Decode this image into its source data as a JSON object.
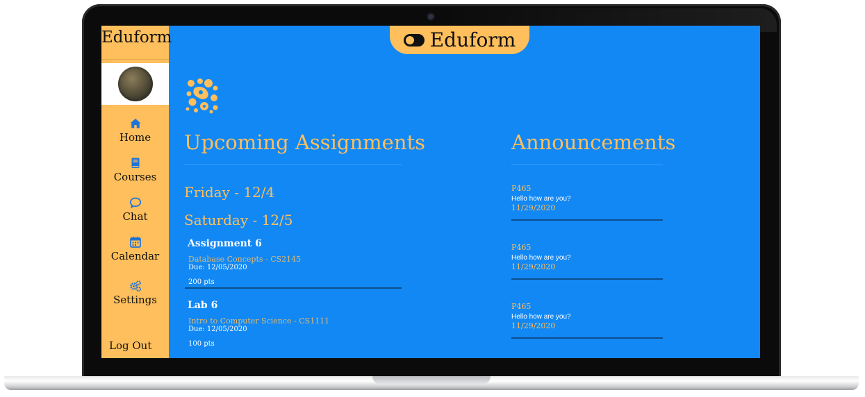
{
  "app": {
    "brand": "Eduform",
    "tab_title": "Eduform"
  },
  "colors": {
    "screen_bg": "#1288f5",
    "accent": "#ffbf5c",
    "sidebar_bg": "#ffbf5c",
    "divider": "#0c4f8c"
  },
  "sidebar": {
    "items": [
      {
        "label": "Home",
        "icon": "home-icon"
      },
      {
        "label": "Courses",
        "icon": "book-icon"
      },
      {
        "label": "Chat",
        "icon": "chat-bubble-icon"
      },
      {
        "label": "Calendar",
        "icon": "calendar-icon"
      },
      {
        "label": "Settings",
        "icon": "gears-icon"
      }
    ],
    "logout_label": "Log Out"
  },
  "main": {
    "assignments_heading": "Upcoming Assignments",
    "announcements_heading": "Announcements",
    "days": [
      {
        "title": "Friday - 12/4"
      },
      {
        "title": "Saturday - 12/5"
      }
    ],
    "assignments": [
      {
        "title": "Assignment 6",
        "course": "Database Concepts - CS2145",
        "due": "Due: 12/05/2020",
        "points": "200 pts"
      },
      {
        "title": "Lab 6",
        "course": "Intro to Computer Science - CS1111",
        "due": "Due: 12/05/2020",
        "points": "100 pts"
      }
    ],
    "announcements": [
      {
        "course": "P465",
        "message": "Hello how are you?",
        "date": "11/29/2020"
      },
      {
        "course": "P465",
        "message": "Hello how are you?",
        "date": "11/29/2020"
      },
      {
        "course": "P465",
        "message": "Hello how are you?",
        "date": "11/29/2020"
      }
    ]
  }
}
